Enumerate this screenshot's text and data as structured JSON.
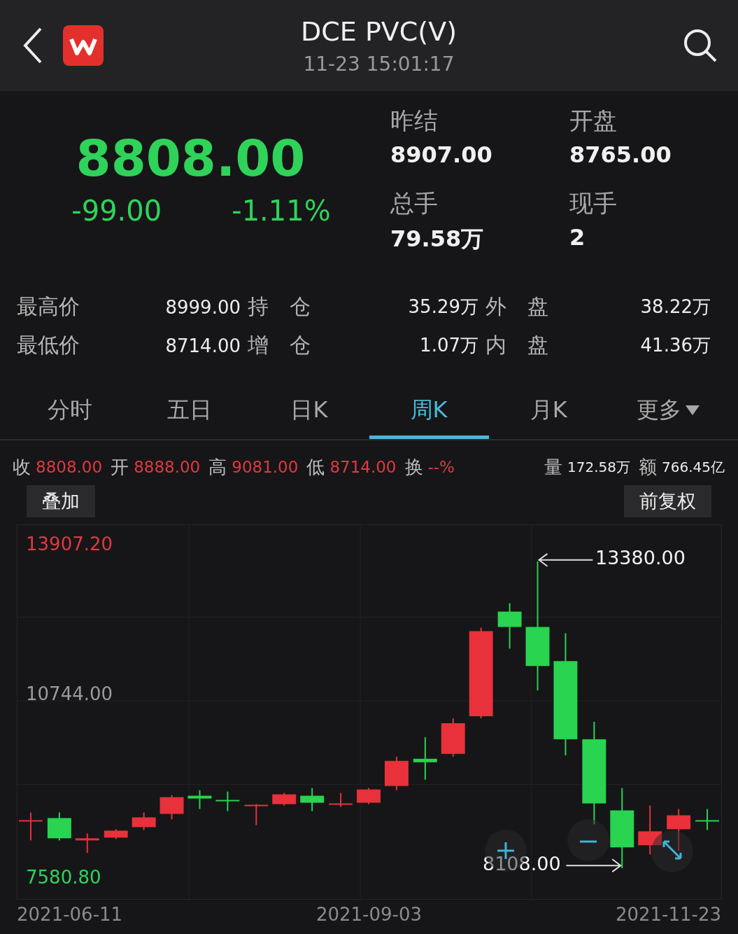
{
  "header": {
    "title": "DCE PVC(V)",
    "time": "11-23 15:01:17"
  },
  "quote": {
    "price": "8808.00",
    "change": "-99.00",
    "change_pct": "-1.11%",
    "stats": [
      {
        "label": "昨结",
        "value": "8907.00"
      },
      {
        "label": "开盘",
        "value": "8765.00"
      },
      {
        "label": "总手",
        "value": "79.58万"
      },
      {
        "label": "现手",
        "value": "2"
      }
    ]
  },
  "details": [
    [
      {
        "label": "最高价",
        "value": "8999.00"
      },
      {
        "label": "持　仓",
        "value": "35.29万"
      },
      {
        "label": "外　盘",
        "value": "38.22万"
      }
    ],
    [
      {
        "label": "最低价",
        "value": "8714.00"
      },
      {
        "label": "增　仓",
        "value": "1.07万"
      },
      {
        "label": "内　盘",
        "value": "41.36万"
      }
    ]
  ],
  "tabs": [
    {
      "label": "分时",
      "selected": false
    },
    {
      "label": "五日",
      "selected": false
    },
    {
      "label": "日K",
      "selected": false
    },
    {
      "label": "周K",
      "selected": true
    },
    {
      "label": "月K",
      "selected": false
    },
    {
      "label": "更多",
      "selected": false,
      "dropdown": true
    }
  ],
  "info_bar": {
    "prices": [
      {
        "label": "收",
        "value": "8808.00"
      },
      {
        "label": "开",
        "value": "8888.00"
      },
      {
        "label": "高",
        "value": "9081.00"
      },
      {
        "label": "低",
        "value": "8714.00"
      },
      {
        "label": "换",
        "value": "--%"
      }
    ],
    "totals": [
      {
        "label": "量",
        "value": "172.58万"
      },
      {
        "label": "额",
        "value": "766.45亿"
      }
    ]
  },
  "chart_buttons": [
    "叠加",
    "前复权"
  ],
  "chart": {
    "y_labels": [
      "13907.20",
      "10744.00",
      "7580.80"
    ],
    "high_marker": "13380.00",
    "low_marker": "8108.00",
    "x_labels": [
      "2021-06-11",
      "2021-09-03",
      "2021-11-23"
    ]
  }
}
